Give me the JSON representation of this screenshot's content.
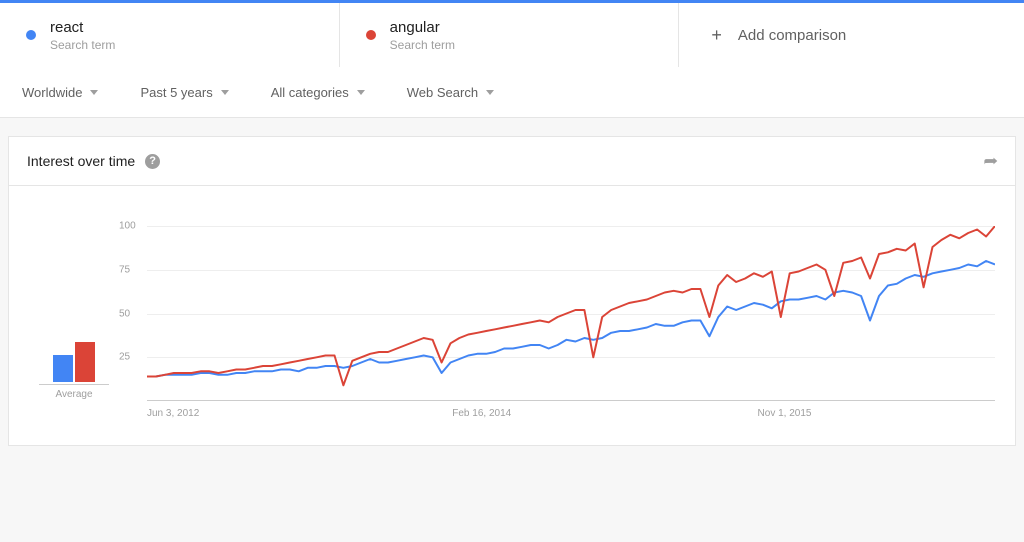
{
  "colors": {
    "react": "#4285f4",
    "angular": "#db4437"
  },
  "terms": [
    {
      "name": "react",
      "type": "Search term",
      "color_key": "react"
    },
    {
      "name": "angular",
      "type": "Search term",
      "color_key": "angular"
    }
  ],
  "add_comparison_label": "Add comparison",
  "filters": {
    "region": "Worldwide",
    "time": "Past 5 years",
    "category": "All categories",
    "type": "Web Search"
  },
  "card": {
    "title": "Interest over time",
    "average_label": "Average"
  },
  "chart_data": {
    "type": "line",
    "title": "Interest over time",
    "ylabel": "",
    "xlabel": "",
    "ylim": [
      0,
      100
    ],
    "yticks": [
      25,
      50,
      75,
      100
    ],
    "xticks": [
      "Jun 3, 2012",
      "Feb 16, 2014",
      "Nov 1, 2015"
    ],
    "averages": {
      "react": 34,
      "angular": 50
    },
    "series": [
      {
        "name": "react",
        "color": "#4285f4",
        "values": [
          14,
          14,
          15,
          15,
          15,
          15,
          16,
          16,
          15,
          15,
          16,
          16,
          17,
          17,
          17,
          18,
          18,
          17,
          19,
          19,
          20,
          20,
          19,
          20,
          22,
          24,
          22,
          22,
          23,
          24,
          25,
          26,
          25,
          16,
          22,
          24,
          26,
          27,
          27,
          28,
          30,
          30,
          31,
          32,
          32,
          30,
          32,
          35,
          34,
          36,
          35,
          36,
          39,
          40,
          40,
          41,
          42,
          44,
          43,
          43,
          45,
          46,
          46,
          37,
          48,
          54,
          52,
          54,
          56,
          55,
          53,
          57,
          58,
          58,
          59,
          60,
          58,
          62,
          63,
          62,
          60,
          46,
          60,
          66,
          67,
          70,
          72,
          71,
          73,
          74,
          75,
          76,
          78,
          77,
          80,
          78
        ]
      },
      {
        "name": "angular",
        "color": "#db4437",
        "values": [
          14,
          14,
          15,
          16,
          16,
          16,
          17,
          17,
          16,
          17,
          18,
          18,
          19,
          20,
          20,
          21,
          22,
          23,
          24,
          25,
          26,
          26,
          9,
          23,
          25,
          27,
          28,
          28,
          30,
          32,
          34,
          36,
          35,
          22,
          33,
          36,
          38,
          39,
          40,
          41,
          42,
          43,
          44,
          45,
          46,
          45,
          48,
          50,
          52,
          52,
          25,
          48,
          52,
          54,
          56,
          57,
          58,
          60,
          62,
          63,
          62,
          64,
          64,
          48,
          66,
          72,
          68,
          70,
          73,
          71,
          74,
          48,
          73,
          74,
          76,
          78,
          75,
          60,
          79,
          80,
          82,
          70,
          84,
          85,
          87,
          86,
          90,
          65,
          88,
          92,
          95,
          93,
          96,
          98,
          94,
          100
        ]
      }
    ]
  }
}
